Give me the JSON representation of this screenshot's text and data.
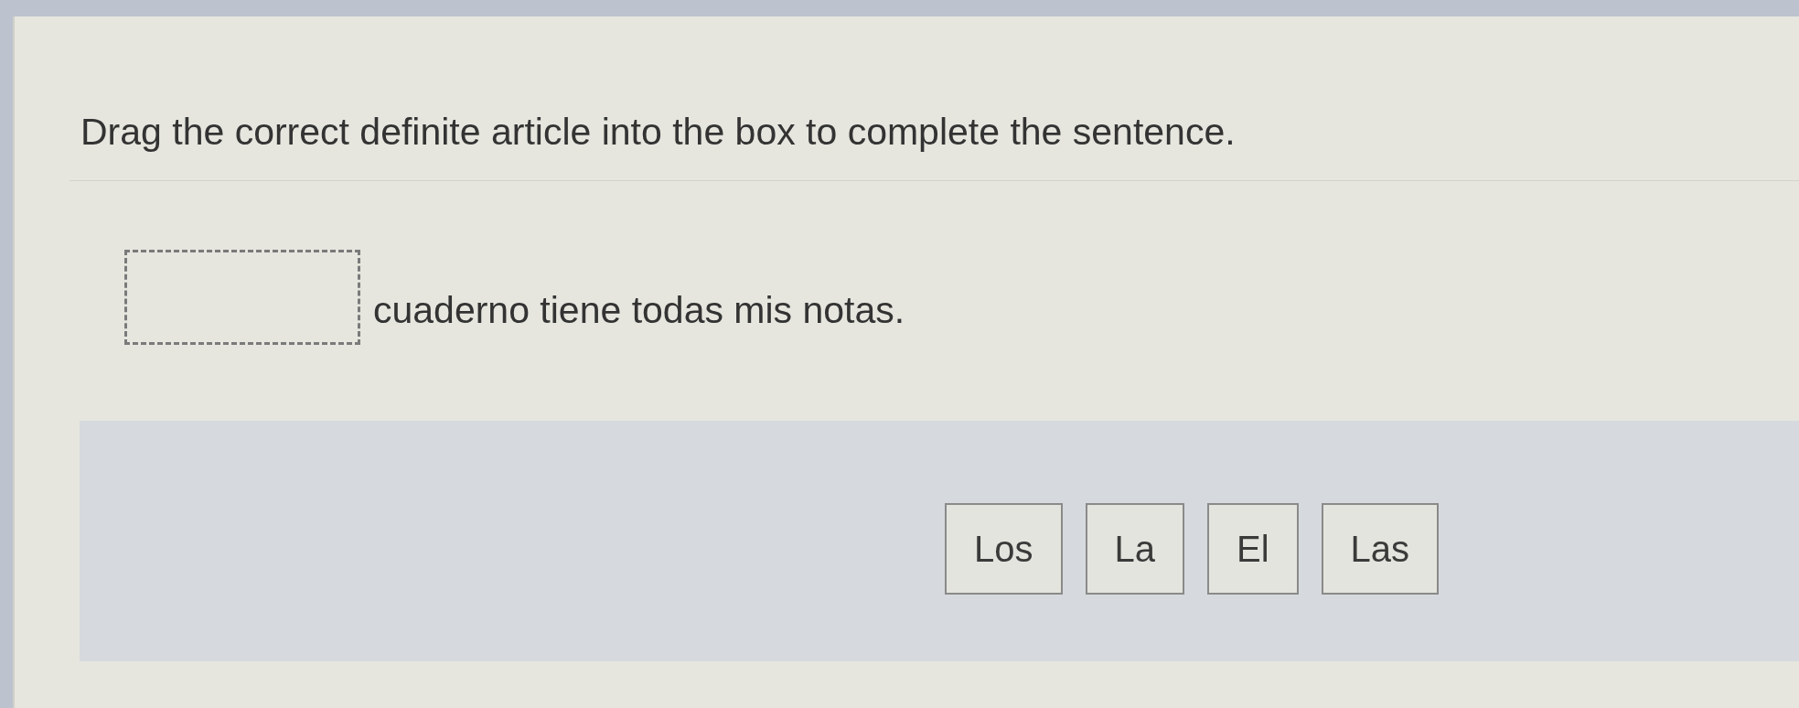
{
  "instruction": "Drag the correct definite article into the box to complete the sentence.",
  "sentence": {
    "after_blank": "cuaderno tiene todas mis notas."
  },
  "choices": [
    {
      "label": "Los"
    },
    {
      "label": "La"
    },
    {
      "label": "El"
    },
    {
      "label": "Las"
    }
  ]
}
